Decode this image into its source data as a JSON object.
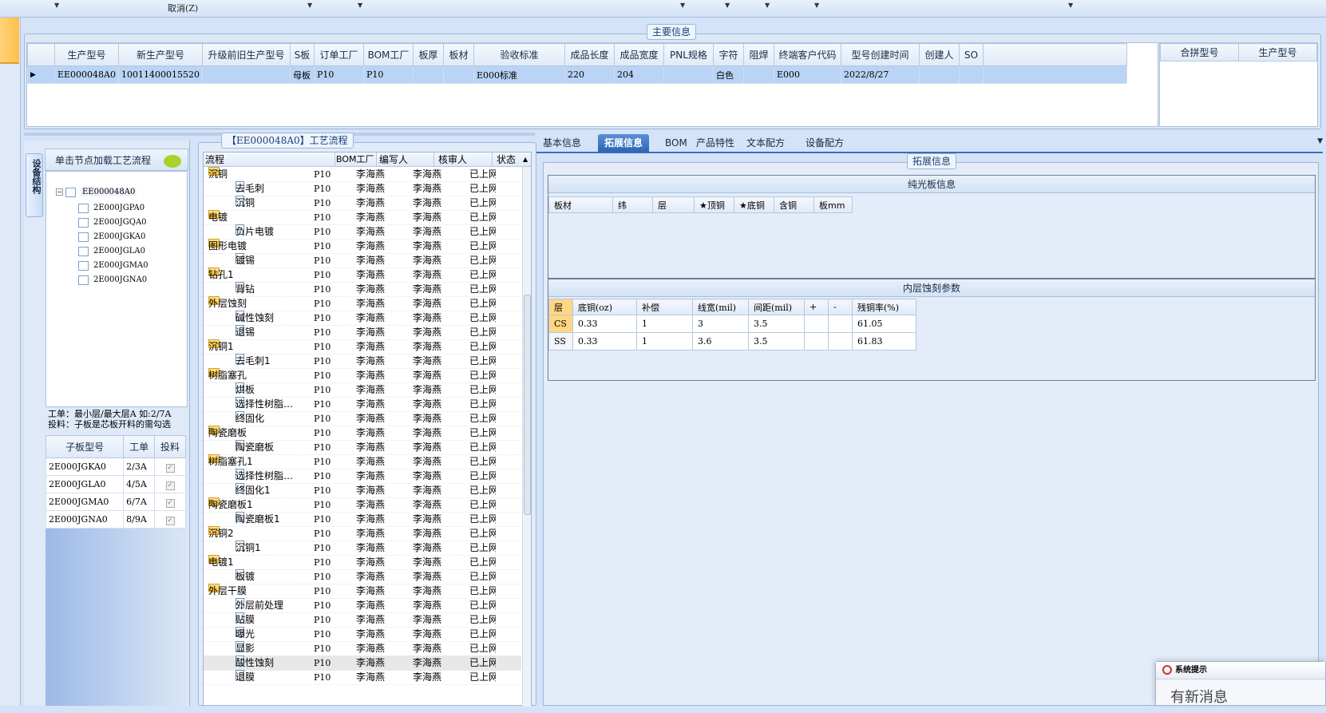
{
  "toolbar": {
    "cancel_label": "取消(Z)"
  },
  "main_info": {
    "title": "主要信息",
    "columns": [
      "生产型号",
      "新生产型号",
      "升级前旧生产型号",
      "S板",
      "订单工厂",
      "BOM工厂",
      "板厚",
      "板材",
      "验收标准",
      "成品长度",
      "成品宽度",
      "PNL规格",
      "字符",
      "阻焊",
      "终端客户代码",
      "型号创建时间",
      "创建人",
      "SO"
    ],
    "row": {
      "生产型号": "EE000048A0",
      "新生产型号": "10011400015520",
      "升级前旧生产型号": "",
      "S板": "母板",
      "订单工厂": "P10",
      "BOM工厂": "P10",
      "板厚": "",
      "板材": "",
      "验收标准": "E000标准",
      "成品长度": "220",
      "成品宽度": "204",
      "PNL规格": "",
      "字符": "白色",
      "阻焊": "",
      "终端客户代码": "E000",
      "型号创建时间": "2022/8/27",
      "创建人": "",
      "SO": ""
    },
    "side_columns": [
      "合拼型号",
      "生产型号"
    ]
  },
  "left_panel": {
    "vertical_tab": "设备结构",
    "tree_header": "单击节点加载工艺流程",
    "tree_root": "EE000048A0",
    "tree_children": [
      "2E000JGPA0",
      "2E000JGQA0",
      "2E000JGKA0",
      "2E000JGLA0",
      "2E000JGMA0",
      "2E000JGNA0"
    ],
    "hint_line1": "工单：最小层/最大层A 如:2/7A",
    "hint_line2": "投料：子板是芯板开料的需勾选",
    "sub_columns": [
      "子板型号",
      "工单",
      "投料"
    ],
    "sub_rows": [
      {
        "model": "2E000JGKA0",
        "order": "2/3A"
      },
      {
        "model": "2E000JGLA0",
        "order": "4/5A"
      },
      {
        "model": "2E000JGMA0",
        "order": "6/7A"
      },
      {
        "model": "2E000JGNA0",
        "order": "8/9A"
      }
    ]
  },
  "process": {
    "title": "【EE000048A0】工艺流程",
    "columns": [
      "流程",
      "BOM工厂",
      "编写人",
      "核审人",
      "状态"
    ],
    "rows": [
      {
        "level": 0,
        "name": "沉铜",
        "bom": "P10",
        "writer": "李海燕",
        "checker": "李海燕",
        "status": "已上网"
      },
      {
        "level": 1,
        "name": "去毛刺",
        "bom": "P10",
        "writer": "李海燕",
        "checker": "李海燕",
        "status": "已上网"
      },
      {
        "level": 1,
        "name": "沉铜",
        "bom": "P10",
        "writer": "李海燕",
        "checker": "李海燕",
        "status": "已上网"
      },
      {
        "level": 0,
        "name": "电镀",
        "bom": "P10",
        "writer": "李海燕",
        "checker": "李海燕",
        "status": "已上网"
      },
      {
        "level": 1,
        "name": "负片电镀",
        "bom": "P10",
        "writer": "李海燕",
        "checker": "李海燕",
        "status": "已上网"
      },
      {
        "level": 0,
        "name": "图形电镀",
        "bom": "P10",
        "writer": "李海燕",
        "checker": "李海燕",
        "status": "已上网"
      },
      {
        "level": 1,
        "name": "镀锡",
        "bom": "P10",
        "writer": "李海燕",
        "checker": "李海燕",
        "status": "已上网"
      },
      {
        "level": 0,
        "name": "钻孔1",
        "bom": "P10",
        "writer": "李海燕",
        "checker": "李海燕",
        "status": "已上网"
      },
      {
        "level": 1,
        "name": "背钻",
        "bom": "P10",
        "writer": "李海燕",
        "checker": "李海燕",
        "status": "已上网"
      },
      {
        "level": 0,
        "name": "外层蚀刻",
        "bom": "P10",
        "writer": "李海燕",
        "checker": "李海燕",
        "status": "已上网"
      },
      {
        "level": 1,
        "name": "碱性蚀刻",
        "bom": "P10",
        "writer": "李海燕",
        "checker": "李海燕",
        "status": "已上网"
      },
      {
        "level": 1,
        "name": "退锡",
        "bom": "P10",
        "writer": "李海燕",
        "checker": "李海燕",
        "status": "已上网"
      },
      {
        "level": 0,
        "name": "沉铜1",
        "bom": "P10",
        "writer": "李海燕",
        "checker": "李海燕",
        "status": "已上网"
      },
      {
        "level": 1,
        "name": "去毛刺1",
        "bom": "P10",
        "writer": "李海燕",
        "checker": "李海燕",
        "status": "已上网"
      },
      {
        "level": 0,
        "name": "树脂塞孔",
        "bom": "P10",
        "writer": "李海燕",
        "checker": "李海燕",
        "status": "已上网"
      },
      {
        "level": 1,
        "name": "烘板",
        "bom": "P10",
        "writer": "李海燕",
        "checker": "李海燕",
        "status": "已上网"
      },
      {
        "level": 1,
        "name": "选择性树脂…",
        "bom": "P10",
        "writer": "李海燕",
        "checker": "李海燕",
        "status": "已上网"
      },
      {
        "level": 1,
        "name": "终固化",
        "bom": "P10",
        "writer": "李海燕",
        "checker": "李海燕",
        "status": "已上网"
      },
      {
        "level": 0,
        "name": "陶瓷磨板",
        "bom": "P10",
        "writer": "李海燕",
        "checker": "李海燕",
        "status": "已上网"
      },
      {
        "level": 1,
        "name": "陶瓷磨板",
        "bom": "P10",
        "writer": "李海燕",
        "checker": "李海燕",
        "status": "已上网"
      },
      {
        "level": 0,
        "name": "树脂塞孔1",
        "bom": "P10",
        "writer": "李海燕",
        "checker": "李海燕",
        "status": "已上网"
      },
      {
        "level": 1,
        "name": "选择性树脂…",
        "bom": "P10",
        "writer": "李海燕",
        "checker": "李海燕",
        "status": "已上网"
      },
      {
        "level": 1,
        "name": "终固化1",
        "bom": "P10",
        "writer": "李海燕",
        "checker": "李海燕",
        "status": "已上网"
      },
      {
        "level": 0,
        "name": "陶瓷磨板1",
        "bom": "P10",
        "writer": "李海燕",
        "checker": "李海燕",
        "status": "已上网"
      },
      {
        "level": 1,
        "name": "陶瓷磨板1",
        "bom": "P10",
        "writer": "李海燕",
        "checker": "李海燕",
        "status": "已上网"
      },
      {
        "level": 0,
        "name": "沉铜2",
        "bom": "P10",
        "writer": "李海燕",
        "checker": "李海燕",
        "status": "已上网"
      },
      {
        "level": 1,
        "name": "沉铜1",
        "bom": "P10",
        "writer": "李海燕",
        "checker": "李海燕",
        "status": "已上网"
      },
      {
        "level": 0,
        "name": "电镀1",
        "bom": "P10",
        "writer": "李海燕",
        "checker": "李海燕",
        "status": "已上网"
      },
      {
        "level": 1,
        "name": "板镀",
        "bom": "P10",
        "writer": "李海燕",
        "checker": "李海燕",
        "status": "已上网"
      },
      {
        "level": 0,
        "name": "外层干膜",
        "bom": "P10",
        "writer": "李海燕",
        "checker": "李海燕",
        "status": "已上网"
      },
      {
        "level": 1,
        "name": "外层前处理",
        "bom": "P10",
        "writer": "李海燕",
        "checker": "李海燕",
        "status": "已上网"
      },
      {
        "level": 1,
        "name": "贴膜",
        "bom": "P10",
        "writer": "李海燕",
        "checker": "李海燕",
        "status": "已上网"
      },
      {
        "level": 1,
        "name": "曝光",
        "bom": "P10",
        "writer": "李海燕",
        "checker": "李海燕",
        "status": "已上网"
      },
      {
        "level": 1,
        "name": "显影",
        "bom": "P10",
        "writer": "李海燕",
        "checker": "李海燕",
        "status": "已上网"
      },
      {
        "level": 1,
        "name": "酸性蚀刻",
        "bom": "P10",
        "writer": "李海燕",
        "checker": "李海燕",
        "status": "已上网"
      },
      {
        "level": 1,
        "name": "退膜",
        "bom": "P10",
        "writer": "李海燕",
        "checker": "李海燕",
        "status": "已上网"
      }
    ]
  },
  "tabs": [
    "基本信息",
    "拓展信息",
    "BOM",
    "产品特性",
    "文本配方",
    "设备配方"
  ],
  "active_tab": "拓展信息",
  "extension": {
    "title": "拓展信息",
    "sec1_title": "纯光板信息",
    "sec1_columns": [
      "板材",
      "纬",
      "层",
      "★顶铜",
      "★底铜",
      "含铜",
      "板mm"
    ],
    "sec2_title": "内层蚀刻参数",
    "sec2_columns": [
      "层",
      "底铜(oz)",
      "补偿",
      "线宽(mil)",
      "间距(mil)",
      "+",
      "-",
      "残铜率(%)"
    ],
    "sec2_rows": [
      {
        "layer": "CS",
        "base": "0.33",
        "comp": "1",
        "width": "3",
        "space": "3.5",
        "plus": "",
        "minus": "",
        "residual": "61.05"
      },
      {
        "layer": "SS",
        "base": "0.33",
        "comp": "1",
        "width": "3.6",
        "space": "3.5",
        "plus": "",
        "minus": "",
        "residual": "61.83"
      }
    ]
  },
  "popup": {
    "title": "系统提示",
    "body": "有新消息"
  }
}
